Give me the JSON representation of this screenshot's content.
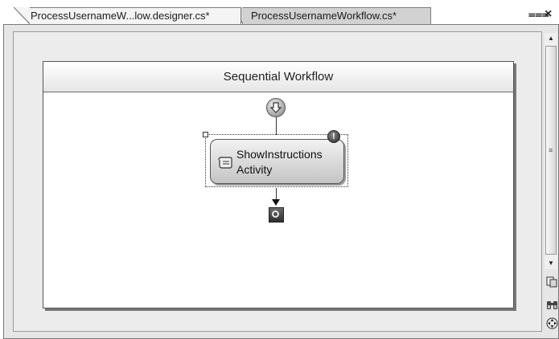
{
  "tabs": [
    {
      "label": "ProcessUsernameW...low.designer.cs*",
      "active": true
    },
    {
      "label": "ProcessUsernameWorkflow.cs*",
      "active": false
    }
  ],
  "window_controls": {
    "pin_glyph": "⩶",
    "close_glyph": "×"
  },
  "workflow": {
    "title": "Sequential Workflow",
    "start_icon": "start-arrow-icon",
    "activity": {
      "label": "ShowInstructions Activity",
      "icon": "scroll-icon",
      "badge": "!"
    },
    "end_icon": "end-circle-icon"
  },
  "scrollbar": {
    "up_glyph": "▲",
    "down_glyph": "▼",
    "grip_glyph": "≡"
  },
  "tools": [
    {
      "name": "zoom-icon"
    },
    {
      "name": "find-icon",
      "glyph": "⚲"
    },
    {
      "name": "pan-icon"
    }
  ],
  "colors": {
    "canvas": "#ececec",
    "workflow_bg": "#ffffff",
    "activity_fill": "#d6d6d6"
  }
}
